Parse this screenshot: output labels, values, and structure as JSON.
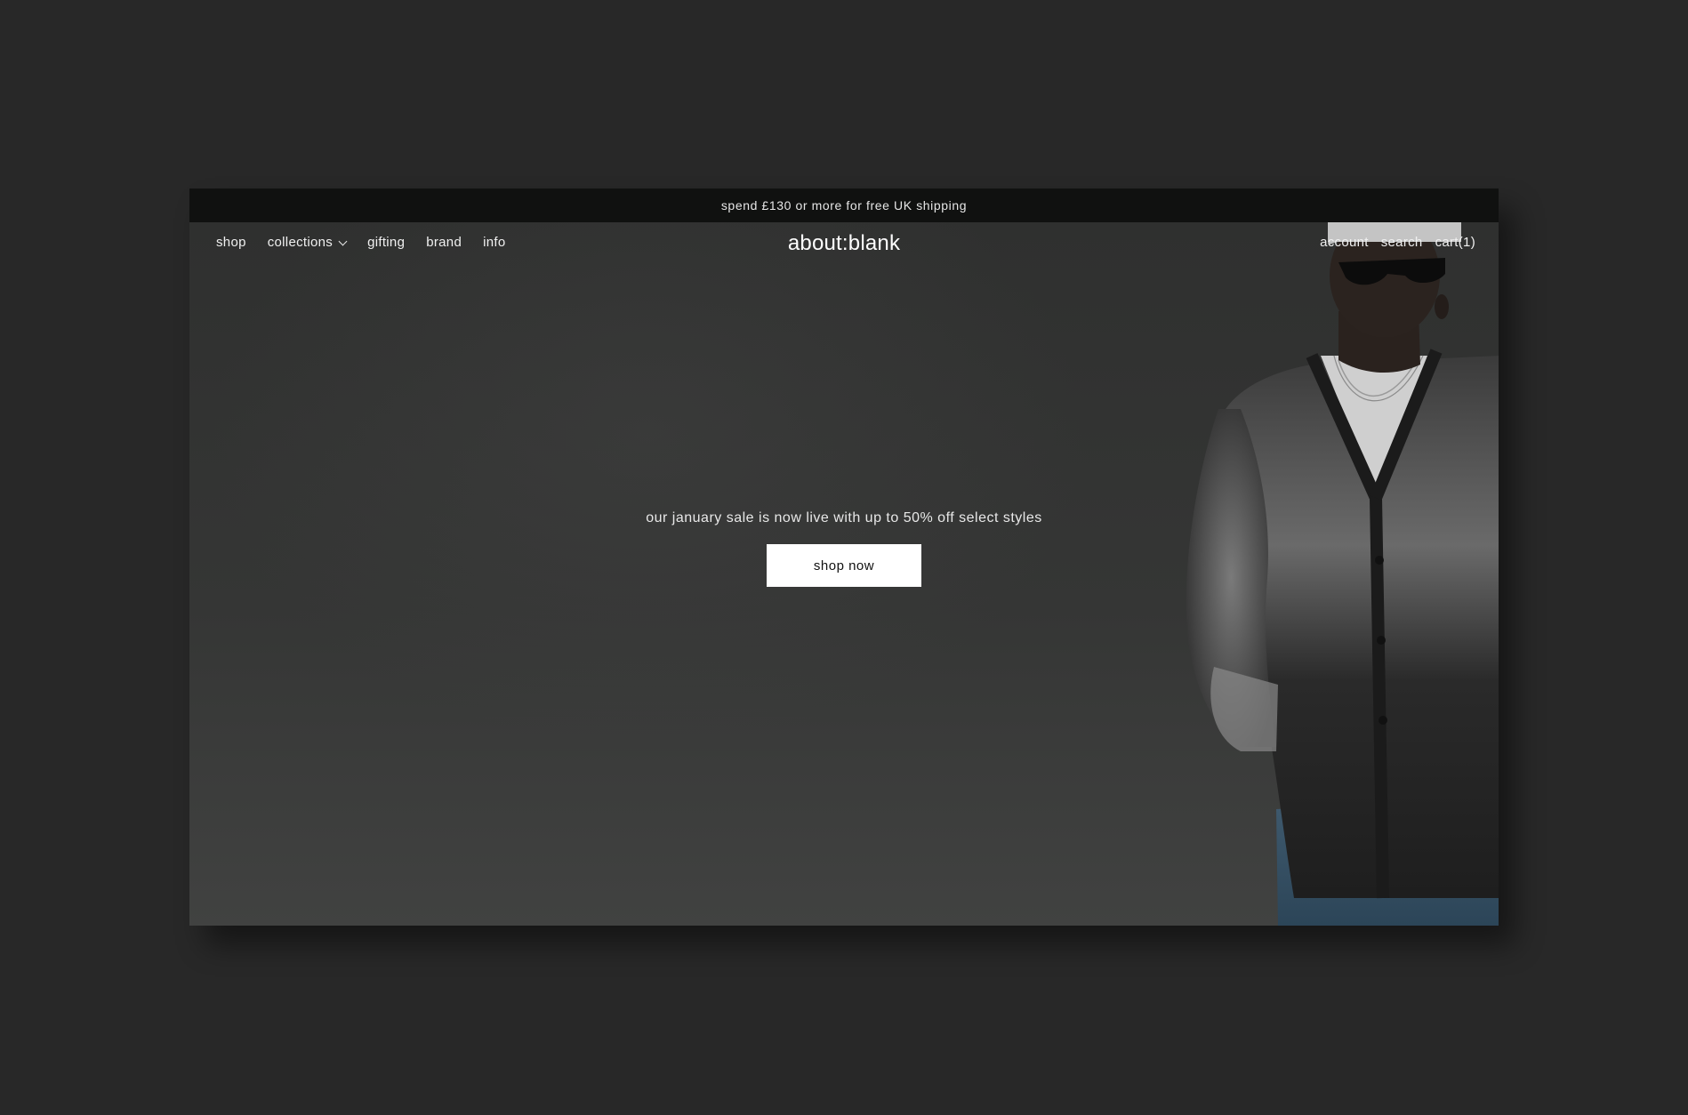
{
  "announcement": {
    "text": "spend £130 or more for free UK shipping"
  },
  "nav": {
    "left_items": [
      {
        "label": "shop"
      },
      {
        "label": "collections"
      },
      {
        "label": "gifting"
      },
      {
        "label": "brand"
      },
      {
        "label": "info"
      }
    ],
    "logo": "about:blank",
    "right_items": [
      {
        "label": "account"
      },
      {
        "label": "search"
      },
      {
        "label": "cart(1)"
      }
    ]
  },
  "hero": {
    "text": "our january sale is now live with up to 50% off select styles",
    "button_label": "shop now"
  },
  "colors": {
    "page_bg": "#282828",
    "announce_bg": "#101110",
    "button_bg": "#ffffff",
    "text": "#f0f0f0"
  },
  "icons": {
    "collections_dropdown": "chevron-down-icon"
  }
}
